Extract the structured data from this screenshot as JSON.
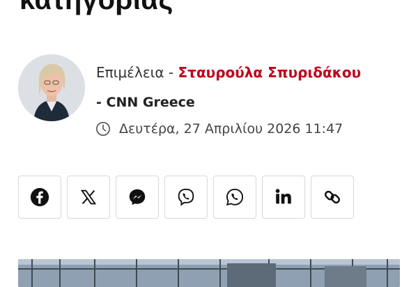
{
  "article": {
    "title_fragment": "κατηγορίας"
  },
  "byline": {
    "prefix": "Επιμέλεια -",
    "author": "Σταυρούλα Σπυριδάκου",
    "agency": "- CNN Greece"
  },
  "dateline": {
    "icon": "clock-icon",
    "text": "Δευτέρα, 27 Απριλίου 2026 11:47"
  },
  "share_buttons": [
    {
      "icon": "facebook-icon"
    },
    {
      "icon": "x-icon"
    },
    {
      "icon": "messenger-icon"
    },
    {
      "icon": "viber-icon"
    },
    {
      "icon": "whatsapp-icon"
    },
    {
      "icon": "linkedin-icon"
    },
    {
      "icon": "link-icon"
    }
  ],
  "colors": {
    "author": "#c0001b",
    "text": "#333333",
    "border": "#d8d8d8"
  }
}
